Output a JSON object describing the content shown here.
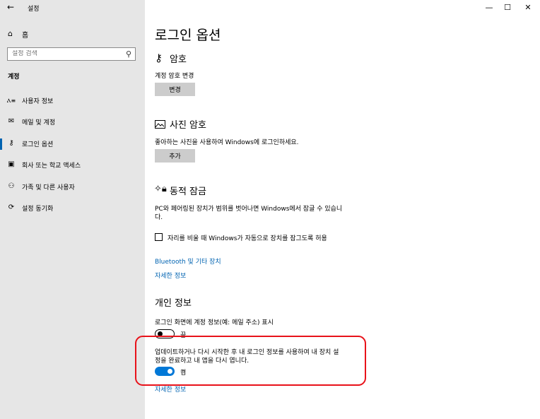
{
  "window": {
    "title": "설정",
    "controls": {
      "minimize": "—",
      "maximize": "☐",
      "close": "✕"
    }
  },
  "sidebar": {
    "home_label": "홈",
    "search_placeholder": "설정 검색",
    "section_title": "계정",
    "items": [
      {
        "label": "사용자 정보",
        "icon": "person-card-icon",
        "glyph": "Ⲁ≡"
      },
      {
        "label": "메일 및 계정",
        "icon": "mail-icon",
        "glyph": "✉"
      },
      {
        "label": "로그인 옵션",
        "icon": "key-icon",
        "glyph": "⚷"
      },
      {
        "label": "회사 또는 학교 액세스",
        "icon": "briefcase-icon",
        "glyph": "▣"
      },
      {
        "label": "가족 및 다른 사용자",
        "icon": "people-icon",
        "glyph": "⚇"
      },
      {
        "label": "설정 동기화",
        "icon": "sync-icon",
        "glyph": "⟳"
      }
    ],
    "selected_index": 2
  },
  "main": {
    "page_title": "로그인 옵션",
    "password": {
      "title": "암호",
      "icon": "key-icon",
      "description": "계정 암호 변경",
      "button": "변경"
    },
    "picture_password": {
      "title": "사진 암호",
      "icon": "picture-icon",
      "description": "좋아하는 사진을 사용하여 Windows에 로그인하세요.",
      "button": "추가"
    },
    "dynamic_lock": {
      "title": "동적 잠금",
      "icon": "dynamic-lock-icon",
      "description_line1": "PC와 페어링된 장치가 범위를 벗어나면 Windows에서 잠글 수 있습니",
      "description_line2": "다.",
      "checkbox_label": "자리를 비울 때 Windows가 자동으로 장치를 잠그도록 허용",
      "checkbox_checked": false,
      "link_bluetooth": "Bluetooth 및 기타 장치",
      "link_more": "자세한 정보"
    },
    "privacy": {
      "title": "개인 정보",
      "show_account_label": "로그인 화면에 계정 정보(예: 메일 주소) 표시",
      "show_account_state": "끔",
      "show_account_on": false,
      "autorestart_label_line1": "업데이트하거나 다시 시작한 후 내 로그인 정보를 사용하여 내 장치 설",
      "autorestart_label_line2": "정을 완료하고 내 앱을 다시 엽니다.",
      "autorestart_state": "켬",
      "autorestart_on": true,
      "link_more": "자세한 정보"
    }
  },
  "colors": {
    "accent": "#0078d7",
    "link": "#0063b1",
    "highlight": "#e8121a",
    "sidebar_bg": "#e6e6e6",
    "button_bg": "#cccccc"
  }
}
